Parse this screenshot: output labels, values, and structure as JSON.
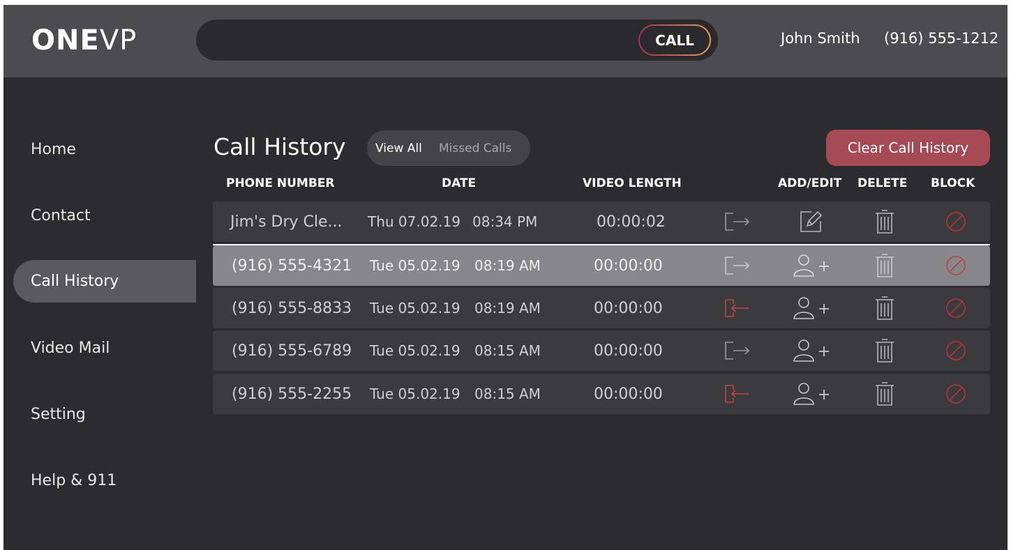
{
  "header": {
    "logo_bold": "ONE",
    "logo_light": "VP",
    "search_value": "",
    "search_placeholder": "",
    "call_label": "CALL",
    "user_name": "John Smith",
    "user_phone": "(916) 555-1212"
  },
  "sidebar": {
    "items": [
      {
        "label": "Home",
        "active": false
      },
      {
        "label": "Contact",
        "active": false
      },
      {
        "label": "Call History",
        "active": true
      },
      {
        "label": "Video Mail",
        "active": false
      },
      {
        "label": "Setting",
        "active": false
      },
      {
        "label": "Help & 911",
        "active": false
      }
    ]
  },
  "main": {
    "title": "Call History",
    "filters": [
      {
        "label": "View All",
        "active": true
      },
      {
        "label": "Missed Calls",
        "active": false
      }
    ],
    "clear_label": "Clear Call History",
    "columns": {
      "phone": "PHONE NUMBER",
      "date": "DATE",
      "length": "VIDEO LENGTH",
      "add_edit": "ADD/EDIT",
      "delete": "DELETE",
      "block": "BLOCK"
    },
    "rows": [
      {
        "phone": "Jim's Dry Cle...",
        "day_date": "Thu 07.02.19",
        "time": "08:34 PM",
        "length": "00:00:02",
        "direction": "outgoing",
        "action_icon": "edit-icon",
        "selected": false
      },
      {
        "phone": "(916) 555-4321",
        "day_date": "Tue 05.02.19",
        "time": "08:19 AM",
        "length": "00:00:00",
        "direction": "outgoing",
        "action_icon": "add-contact-icon",
        "selected": true
      },
      {
        "phone": "(916) 555-8833",
        "day_date": "Tue 05.02.19",
        "time": "08:19 AM",
        "length": "00:00:00",
        "direction": "incoming-missed",
        "action_icon": "add-contact-icon",
        "selected": false
      },
      {
        "phone": "(916) 555-6789",
        "day_date": "Tue 05.02.19",
        "time": "08:15 AM",
        "length": "00:00:00",
        "direction": "outgoing",
        "action_icon": "add-contact-icon",
        "selected": false
      },
      {
        "phone": "(916) 555-2255",
        "day_date": "Tue 05.02.19",
        "time": "08:15 AM",
        "length": "00:00:00",
        "direction": "incoming-missed",
        "action_icon": "add-contact-icon",
        "selected": false
      }
    ]
  },
  "colors": {
    "missed": "#c0424f",
    "block": "#a8323e",
    "accent": "#a64a55"
  }
}
